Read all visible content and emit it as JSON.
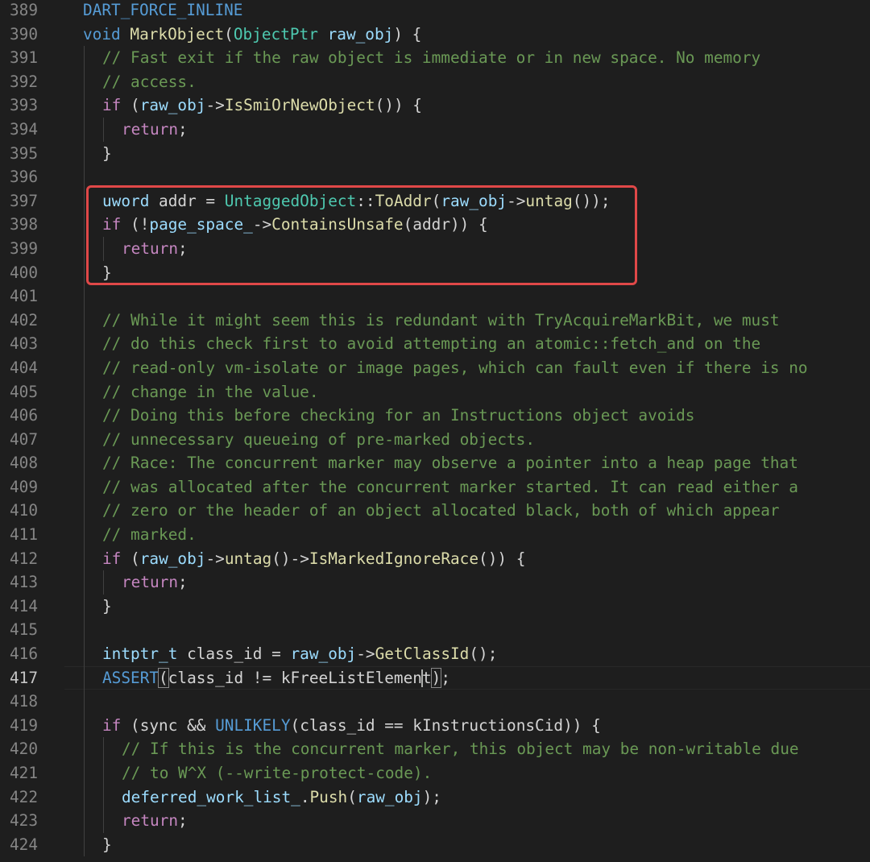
{
  "editor": {
    "theme_colors": {
      "background": "#1e1e1e",
      "keyword": "#569cd6",
      "control": "#c586c0",
      "type": "#4ec9b0",
      "function": "#dcdcaa",
      "variable": "#9cdcfe",
      "comment": "#6a9955",
      "highlight_box": "#e04848"
    },
    "active_line": 417,
    "highlighted_lines": [
      397,
      398,
      399,
      400
    ],
    "lines": [
      {
        "n": "389",
        "indent": 0,
        "tokens": [
          [
            "kw",
            "DART_FORCE_INLINE"
          ]
        ]
      },
      {
        "n": "390",
        "indent": 0,
        "tokens": [
          [
            "kw",
            "void"
          ],
          [
            "op",
            " "
          ],
          [
            "fn",
            "MarkObject"
          ],
          [
            "op",
            "("
          ],
          [
            "type",
            "ObjectPtr"
          ],
          [
            "op",
            " "
          ],
          [
            "var",
            "raw_obj"
          ],
          [
            "op",
            ") {"
          ]
        ]
      },
      {
        "n": "391",
        "indent": 1,
        "tokens": [
          [
            "com",
            "// Fast exit if the raw object is immediate or in new space. No memory"
          ]
        ]
      },
      {
        "n": "392",
        "indent": 1,
        "tokens": [
          [
            "com",
            "// access."
          ]
        ]
      },
      {
        "n": "393",
        "indent": 1,
        "tokens": [
          [
            "ctl",
            "if"
          ],
          [
            "op",
            " ("
          ],
          [
            "var",
            "raw_obj"
          ],
          [
            "op",
            "->"
          ],
          [
            "fn",
            "IsSmiOrNewObject"
          ],
          [
            "op",
            "()) {"
          ]
        ]
      },
      {
        "n": "394",
        "indent": 2,
        "tokens": [
          [
            "ctl",
            "return"
          ],
          [
            "op",
            ";"
          ]
        ]
      },
      {
        "n": "395",
        "indent": 1,
        "tokens": [
          [
            "op",
            "}"
          ]
        ]
      },
      {
        "n": "396",
        "indent": 1,
        "tokens": []
      },
      {
        "n": "397",
        "indent": 1,
        "tokens": [
          [
            "var",
            "uword"
          ],
          [
            "op",
            " addr = "
          ],
          [
            "type",
            "UntaggedObject"
          ],
          [
            "op",
            "::"
          ],
          [
            "fn",
            "ToAddr"
          ],
          [
            "op",
            "("
          ],
          [
            "var",
            "raw_obj"
          ],
          [
            "op",
            "->"
          ],
          [
            "fn",
            "untag"
          ],
          [
            "op",
            "());"
          ]
        ]
      },
      {
        "n": "398",
        "indent": 1,
        "tokens": [
          [
            "ctl",
            "if"
          ],
          [
            "op",
            " (!"
          ],
          [
            "var",
            "page_space_"
          ],
          [
            "op",
            "->"
          ],
          [
            "fn",
            "ContainsUnsafe"
          ],
          [
            "op",
            "(addr)) {"
          ]
        ]
      },
      {
        "n": "399",
        "indent": 2,
        "tokens": [
          [
            "ctl",
            "return"
          ],
          [
            "op",
            ";"
          ]
        ]
      },
      {
        "n": "400",
        "indent": 1,
        "tokens": [
          [
            "op",
            "}"
          ]
        ]
      },
      {
        "n": "401",
        "indent": 1,
        "tokens": []
      },
      {
        "n": "402",
        "indent": 1,
        "tokens": [
          [
            "com",
            "// While it might seem this is redundant with TryAcquireMarkBit, we must"
          ]
        ]
      },
      {
        "n": "403",
        "indent": 1,
        "tokens": [
          [
            "com",
            "// do this check first to avoid attempting an atomic::fetch_and on the"
          ]
        ]
      },
      {
        "n": "404",
        "indent": 1,
        "tokens": [
          [
            "com",
            "// read-only vm-isolate or image pages, which can fault even if there is no"
          ]
        ]
      },
      {
        "n": "405",
        "indent": 1,
        "tokens": [
          [
            "com",
            "// change in the value."
          ]
        ]
      },
      {
        "n": "406",
        "indent": 1,
        "tokens": [
          [
            "com",
            "// Doing this before checking for an Instructions object avoids"
          ]
        ]
      },
      {
        "n": "407",
        "indent": 1,
        "tokens": [
          [
            "com",
            "// unnecessary queueing of pre-marked objects."
          ]
        ]
      },
      {
        "n": "408",
        "indent": 1,
        "tokens": [
          [
            "com",
            "// Race: The concurrent marker may observe a pointer into a heap page that"
          ]
        ]
      },
      {
        "n": "409",
        "indent": 1,
        "tokens": [
          [
            "com",
            "// was allocated after the concurrent marker started. It can read either a"
          ]
        ]
      },
      {
        "n": "410",
        "indent": 1,
        "tokens": [
          [
            "com",
            "// zero or the header of an object allocated black, both of which appear"
          ]
        ]
      },
      {
        "n": "411",
        "indent": 1,
        "tokens": [
          [
            "com",
            "// marked."
          ]
        ]
      },
      {
        "n": "412",
        "indent": 1,
        "tokens": [
          [
            "ctl",
            "if"
          ],
          [
            "op",
            " ("
          ],
          [
            "var",
            "raw_obj"
          ],
          [
            "op",
            "->"
          ],
          [
            "fn",
            "untag"
          ],
          [
            "op",
            "()->"
          ],
          [
            "fn",
            "IsMarkedIgnoreRace"
          ],
          [
            "op",
            "()) {"
          ]
        ]
      },
      {
        "n": "413",
        "indent": 2,
        "tokens": [
          [
            "ctl",
            "return"
          ],
          [
            "op",
            ";"
          ]
        ]
      },
      {
        "n": "414",
        "indent": 1,
        "tokens": [
          [
            "op",
            "}"
          ]
        ]
      },
      {
        "n": "415",
        "indent": 1,
        "tokens": []
      },
      {
        "n": "416",
        "indent": 1,
        "tokens": [
          [
            "var",
            "intptr_t"
          ],
          [
            "op",
            " class_id = "
          ],
          [
            "var",
            "raw_obj"
          ],
          [
            "op",
            "->"
          ],
          [
            "fn",
            "GetClassId"
          ],
          [
            "op",
            "();"
          ]
        ]
      },
      {
        "n": "417",
        "indent": 1,
        "tokens": [
          [
            "mac",
            "ASSERT"
          ],
          [
            "brk",
            "("
          ],
          [
            "op",
            "class_id != kFreeListElemen"
          ],
          [
            "caret",
            ""
          ],
          [
            "op",
            "t"
          ],
          [
            "brk",
            ")"
          ],
          [
            "op",
            ";"
          ]
        ]
      },
      {
        "n": "418",
        "indent": 1,
        "tokens": []
      },
      {
        "n": "419",
        "indent": 1,
        "tokens": [
          [
            "ctl",
            "if"
          ],
          [
            "op",
            " (sync && "
          ],
          [
            "mac",
            "UNLIKELY"
          ],
          [
            "op",
            "(class_id == kInstructionsCid)) {"
          ]
        ]
      },
      {
        "n": "420",
        "indent": 2,
        "tokens": [
          [
            "com",
            "// If this is the concurrent marker, this object may be non-writable due"
          ]
        ]
      },
      {
        "n": "421",
        "indent": 2,
        "tokens": [
          [
            "com",
            "// to W^X (--write-protect-code)."
          ]
        ]
      },
      {
        "n": "422",
        "indent": 2,
        "tokens": [
          [
            "var",
            "deferred_work_list_"
          ],
          [
            "op",
            "."
          ],
          [
            "fn",
            "Push"
          ],
          [
            "op",
            "("
          ],
          [
            "var",
            "raw_obj"
          ],
          [
            "op",
            ");"
          ]
        ]
      },
      {
        "n": "423",
        "indent": 2,
        "tokens": [
          [
            "ctl",
            "return"
          ],
          [
            "op",
            ";"
          ]
        ]
      },
      {
        "n": "424",
        "indent": 1,
        "tokens": [
          [
            "op",
            "}"
          ]
        ]
      }
    ]
  }
}
